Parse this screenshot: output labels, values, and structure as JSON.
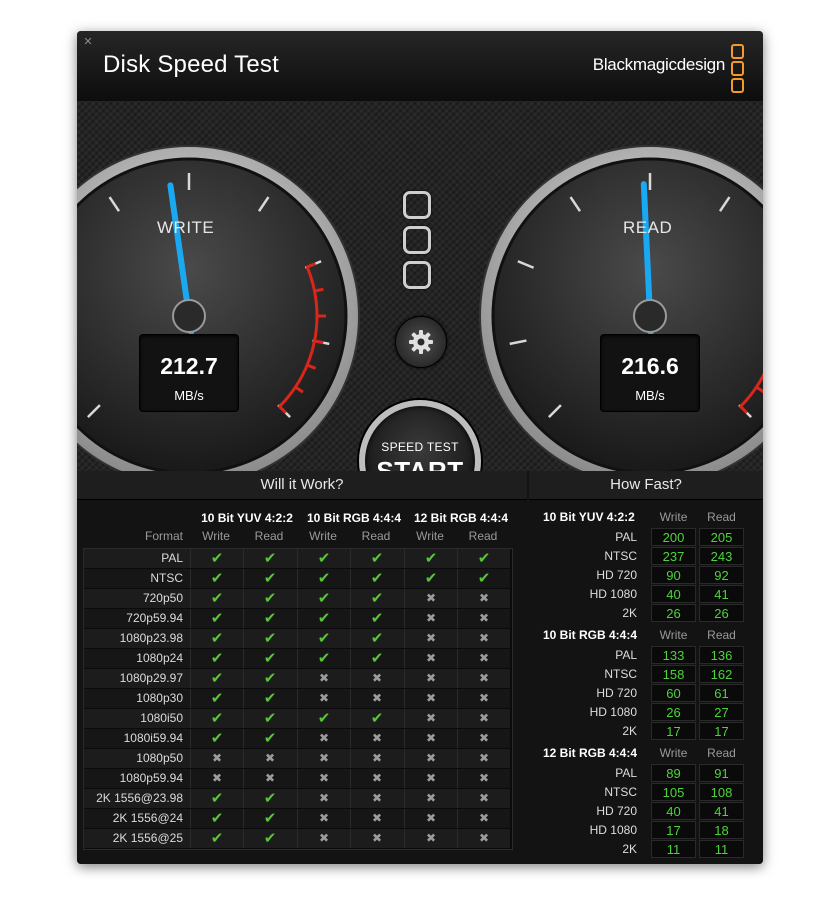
{
  "window": {
    "title": "Disk Speed Test",
    "brand": "Blackmagicdesign",
    "close_glyph": "✕"
  },
  "gauges": {
    "write": {
      "label": "WRITE",
      "value": "212.7",
      "unit": "MB/s",
      "needle_level": 0.47
    },
    "read": {
      "label": "READ",
      "value": "216.6",
      "unit": "MB/s",
      "needle_level": 0.49
    },
    "redzone_color": "#d8261a",
    "needle_color": "#1aa8f0"
  },
  "controls": {
    "start_sub": "SPEED TEST",
    "start_main": "START",
    "settings_icon": "gear-icon"
  },
  "will_it_work": {
    "title": "Will it Work?",
    "format_header": "Format",
    "groups": [
      "10 Bit YUV 4:2:2",
      "10 Bit RGB 4:4:4",
      "12 Bit RGB 4:4:4"
    ],
    "sub_headers": [
      "Write",
      "Read"
    ],
    "rows": [
      {
        "format": "PAL",
        "marks": [
          1,
          1,
          1,
          1,
          1,
          1
        ]
      },
      {
        "format": "NTSC",
        "marks": [
          1,
          1,
          1,
          1,
          1,
          1
        ]
      },
      {
        "format": "720p50",
        "marks": [
          1,
          1,
          1,
          1,
          0,
          0
        ]
      },
      {
        "format": "720p59.94",
        "marks": [
          1,
          1,
          1,
          1,
          0,
          0
        ]
      },
      {
        "format": "1080p23.98",
        "marks": [
          1,
          1,
          1,
          1,
          0,
          0
        ]
      },
      {
        "format": "1080p24",
        "marks": [
          1,
          1,
          1,
          1,
          0,
          0
        ]
      },
      {
        "format": "1080p29.97",
        "marks": [
          1,
          1,
          0,
          0,
          0,
          0
        ]
      },
      {
        "format": "1080p30",
        "marks": [
          1,
          1,
          0,
          0,
          0,
          0
        ]
      },
      {
        "format": "1080i50",
        "marks": [
          1,
          1,
          1,
          1,
          0,
          0
        ]
      },
      {
        "format": "1080i59.94",
        "marks": [
          1,
          1,
          0,
          0,
          0,
          0
        ]
      },
      {
        "format": "1080p50",
        "marks": [
          0,
          0,
          0,
          0,
          0,
          0
        ]
      },
      {
        "format": "1080p59.94",
        "marks": [
          0,
          0,
          0,
          0,
          0,
          0
        ]
      },
      {
        "format": "2K 1556@23.98",
        "marks": [
          1,
          1,
          0,
          0,
          0,
          0
        ]
      },
      {
        "format": "2K 1556@24",
        "marks": [
          1,
          1,
          0,
          0,
          0,
          0
        ]
      },
      {
        "format": "2K 1556@25",
        "marks": [
          1,
          1,
          0,
          0,
          0,
          0
        ]
      }
    ],
    "check_glyph": "✔",
    "cross_glyph": "✖"
  },
  "how_fast": {
    "title": "How Fast?",
    "sub_headers": [
      "Write",
      "Read"
    ],
    "groups": [
      {
        "name": "10 Bit YUV 4:2:2",
        "rows": [
          {
            "format": "PAL",
            "write": "200",
            "read": "205"
          },
          {
            "format": "NTSC",
            "write": "237",
            "read": "243"
          },
          {
            "format": "HD 720",
            "write": "90",
            "read": "92"
          },
          {
            "format": "HD 1080",
            "write": "40",
            "read": "41"
          },
          {
            "format": "2K",
            "write": "26",
            "read": "26"
          }
        ]
      },
      {
        "name": "10 Bit RGB 4:4:4",
        "rows": [
          {
            "format": "PAL",
            "write": "133",
            "read": "136"
          },
          {
            "format": "NTSC",
            "write": "158",
            "read": "162"
          },
          {
            "format": "HD 720",
            "write": "60",
            "read": "61"
          },
          {
            "format": "HD 1080",
            "write": "26",
            "read": "27"
          },
          {
            "format": "2K",
            "write": "17",
            "read": "17"
          }
        ]
      },
      {
        "name": "12 Bit RGB 4:4:4",
        "rows": [
          {
            "format": "PAL",
            "write": "89",
            "read": "91"
          },
          {
            "format": "NTSC",
            "write": "105",
            "read": "108"
          },
          {
            "format": "HD 720",
            "write": "40",
            "read": "41"
          },
          {
            "format": "HD 1080",
            "write": "17",
            "read": "18"
          },
          {
            "format": "2K",
            "write": "11",
            "read": "11"
          }
        ]
      }
    ]
  }
}
